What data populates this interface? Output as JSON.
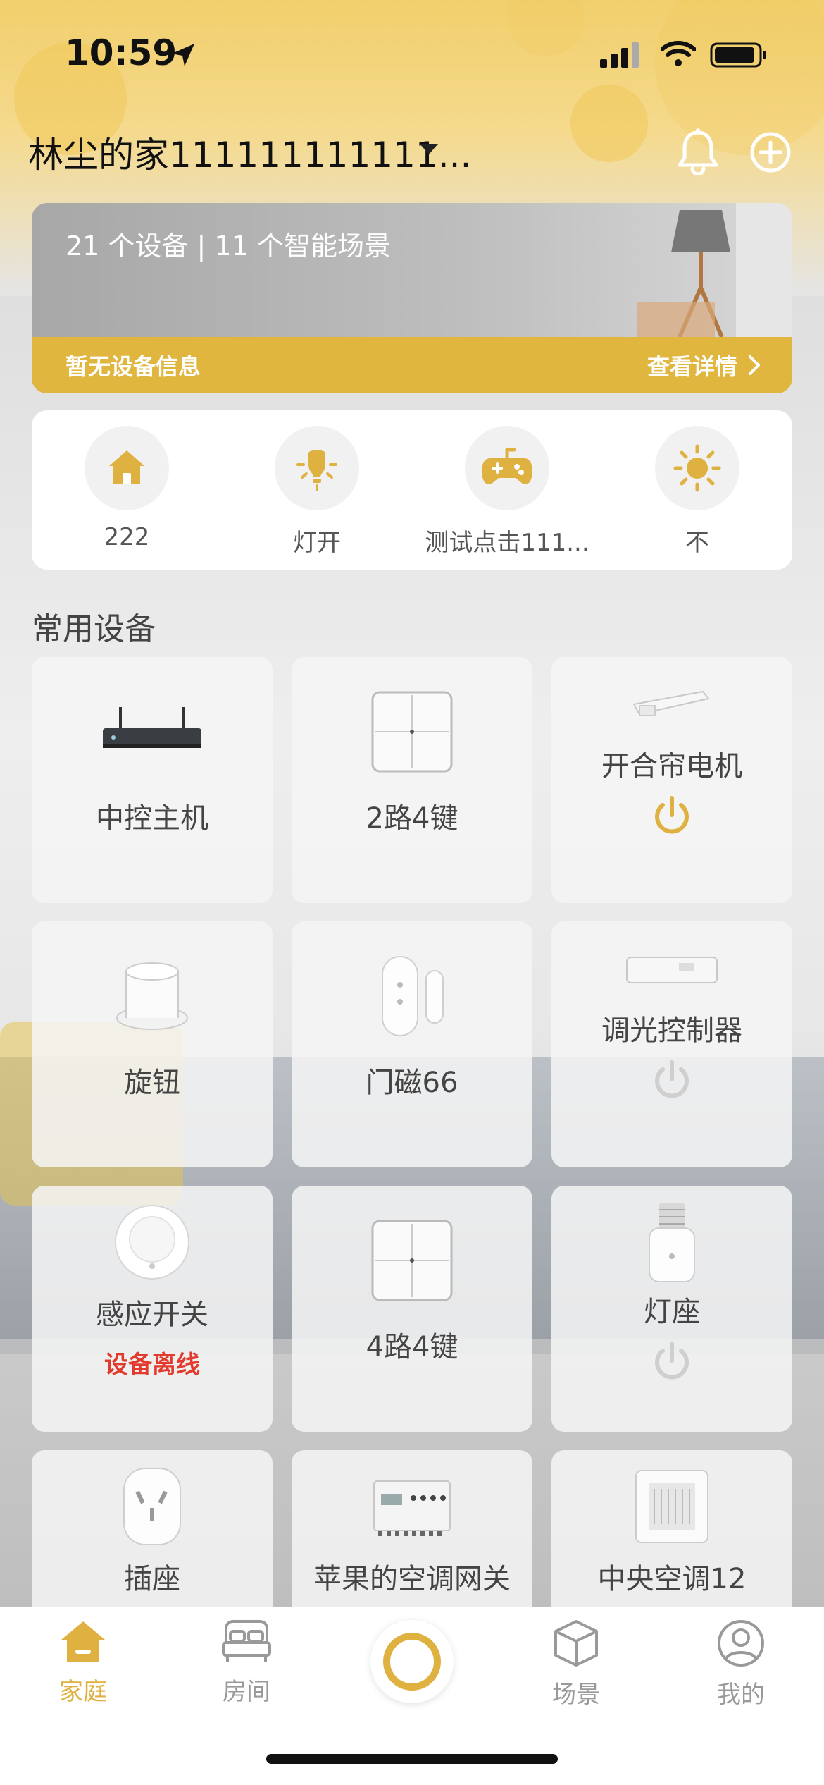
{
  "status_bar": {
    "time": "10:59"
  },
  "header": {
    "home_name": "林尘的家111111111111..."
  },
  "banner": {
    "stats": "21 个设备 | 11 个智能场景",
    "info": "暂无设备信息",
    "detail": "查看详情"
  },
  "scenes": [
    {
      "label": "222",
      "icon": "home-icon"
    },
    {
      "label": "灯开",
      "icon": "bulb-icon"
    },
    {
      "label": "测试点击111...",
      "icon": "gamepad-icon"
    },
    {
      "label": "不",
      "icon": "sun-icon"
    }
  ],
  "section": {
    "title": "常用设备"
  },
  "devices": [
    {
      "name": "中控主机",
      "image": "gateway",
      "power": null,
      "status": null
    },
    {
      "name": "2路4键",
      "image": "switch",
      "power": null,
      "status": null
    },
    {
      "name": "开合帘电机",
      "image": "curtain-motor",
      "power": "on",
      "status": null
    },
    {
      "name": "旋钮",
      "image": "knob",
      "power": null,
      "status": null
    },
    {
      "name": "门磁66",
      "image": "door-sensor",
      "power": null,
      "status": null
    },
    {
      "name": "调光控制器",
      "image": "dimmer",
      "power": "off",
      "status": null
    },
    {
      "name": "感应开关",
      "image": "motion-sensor",
      "power": null,
      "status": "设备离线"
    },
    {
      "name": "4路4键",
      "image": "switch",
      "power": null,
      "status": null
    },
    {
      "name": "灯座",
      "image": "lamp-holder",
      "power": "off",
      "status": null
    },
    {
      "name": "插座",
      "image": "socket",
      "power": null,
      "status": null
    },
    {
      "name": "苹果的空调网关",
      "image": "ac-gateway",
      "power": null,
      "status": null
    },
    {
      "name": "中央空调12",
      "image": "central-ac",
      "power": null,
      "status": null
    }
  ],
  "tabs": [
    {
      "label": "家庭",
      "icon": "home-tab-icon",
      "active": true
    },
    {
      "label": "房间",
      "icon": "bed-icon",
      "active": false
    },
    {
      "label": "场景",
      "icon": "cube-icon",
      "active": false
    },
    {
      "label": "我的",
      "icon": "profile-icon",
      "active": false
    }
  ],
  "colors": {
    "accent": "#DFB140",
    "offline": "#E23B2E",
    "power_on": "#DFB140",
    "power_off": "#CFCFCF"
  }
}
